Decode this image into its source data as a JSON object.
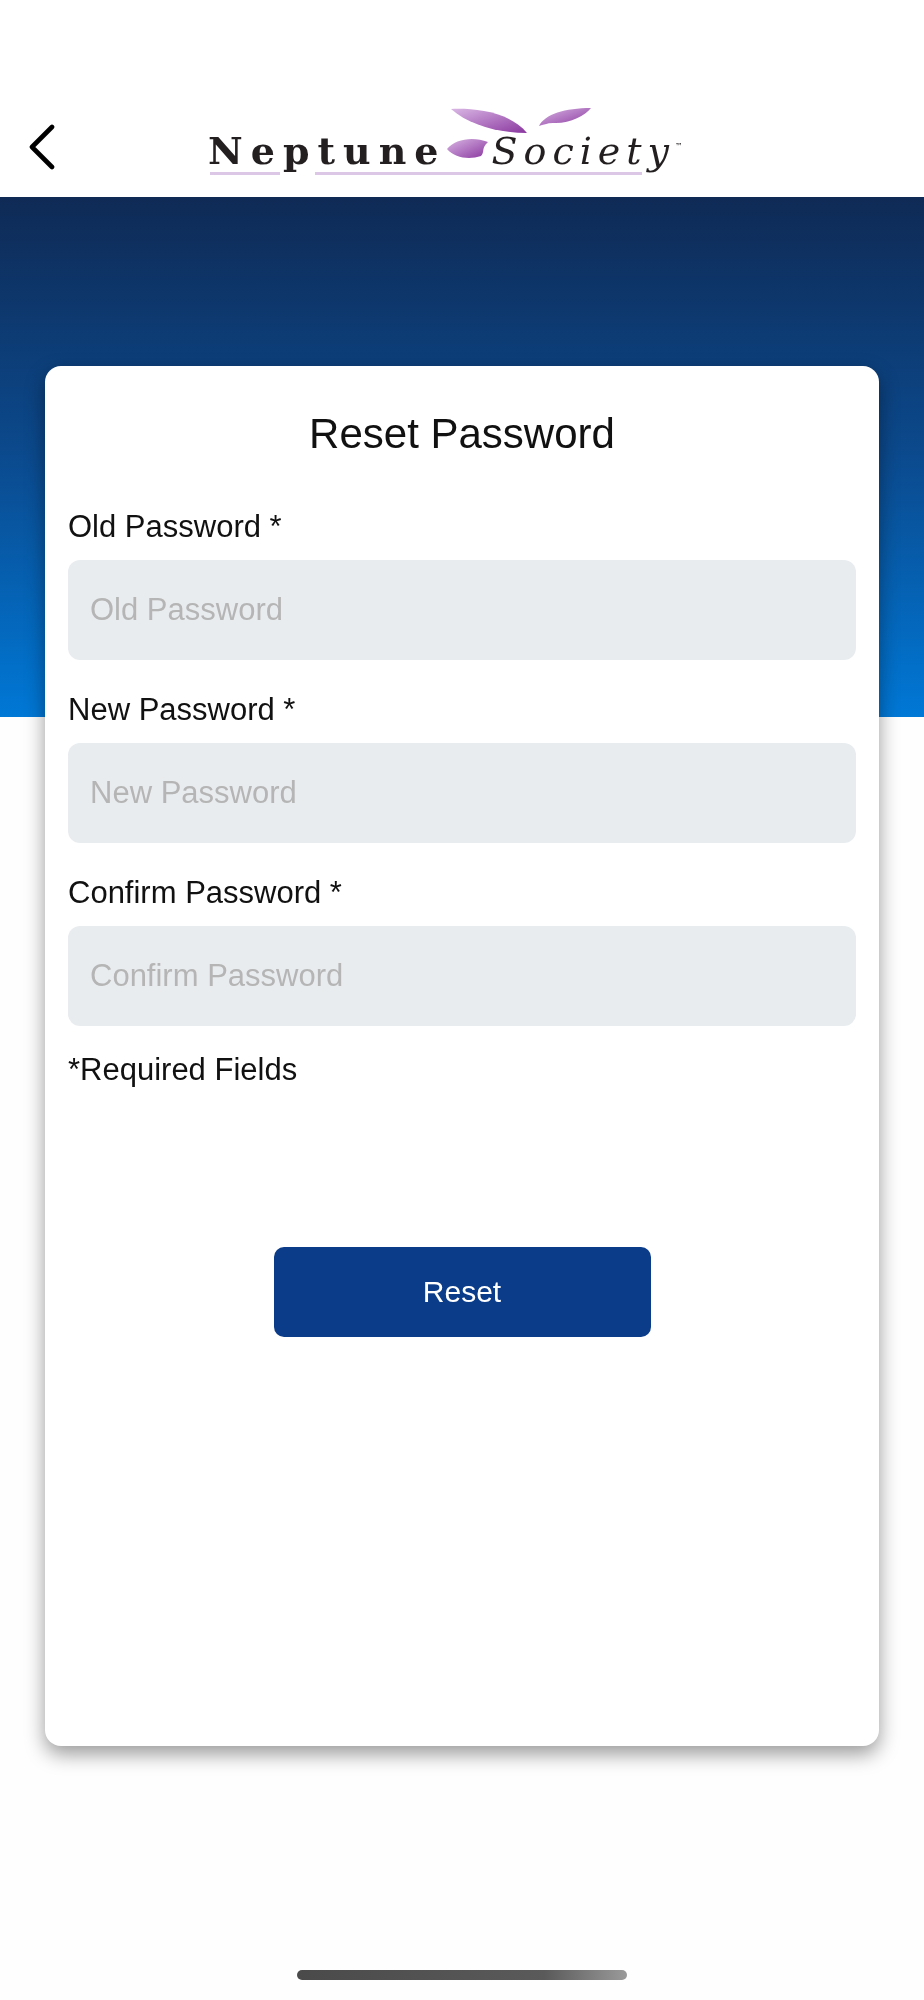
{
  "header": {
    "logo": {
      "first_word": "Neptune",
      "second_word": "Society",
      "mark": "™"
    }
  },
  "form": {
    "title": "Reset Password",
    "fields": [
      {
        "label": "Old Password *",
        "placeholder": "Old Password"
      },
      {
        "label": "New Password *",
        "placeholder": "New Password"
      },
      {
        "label": "Confirm Password *",
        "placeholder": "Confirm Password"
      }
    ],
    "note": "*Required Fields",
    "button": "Reset"
  }
}
